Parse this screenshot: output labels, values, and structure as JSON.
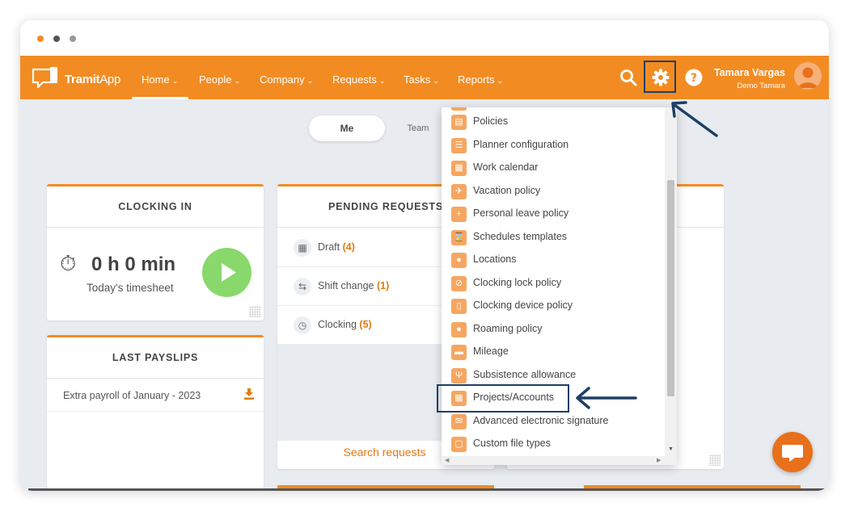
{
  "window": {
    "dots": [
      "#f28c22",
      "#555555",
      "#999999"
    ]
  },
  "navbar": {
    "brand": "TramitApp",
    "brand_parts": [
      "Tramit",
      "App"
    ],
    "color": "#f28c22",
    "items": [
      {
        "label": "Home"
      },
      {
        "label": "People"
      },
      {
        "label": "Company"
      },
      {
        "label": "Requests"
      },
      {
        "label": "Tasks"
      },
      {
        "label": "Reports"
      }
    ],
    "active_item": "Home",
    "icons": [
      "search-icon",
      "gear-icon",
      "help-icon"
    ],
    "user": {
      "name": "Tamara Vargas",
      "company": "Demo Tamara"
    }
  },
  "toggle": {
    "me": "Me",
    "team": "Team",
    "selected": "Me"
  },
  "clocking": {
    "title": "CLOCKING IN",
    "time": "0 h 0 min",
    "subtitle": "Today's timesheet"
  },
  "pending": {
    "title": "PENDING REQUESTS",
    "rows": [
      {
        "label": "Draft",
        "count": "(4)"
      },
      {
        "label": "Shift change",
        "count": "(1)"
      },
      {
        "label": "Clocking",
        "count": "(5)"
      }
    ],
    "search": "Search requests"
  },
  "payslips": {
    "title": "LAST PAYSLIPS",
    "item": "Extra payroll of January - 2023"
  },
  "settings_menu": {
    "items": [
      {
        "label": "Policies",
        "icon": "policies-icon"
      },
      {
        "label": "Planner configuration",
        "icon": "planner-icon"
      },
      {
        "label": "Work calendar",
        "icon": "calendar-icon"
      },
      {
        "label": "Vacation policy",
        "icon": "plane-icon"
      },
      {
        "label": "Personal leave policy",
        "icon": "calendar-plus-icon"
      },
      {
        "label": "Schedules templates",
        "icon": "hourglass-icon"
      },
      {
        "label": "Locations",
        "icon": "location-pin-icon"
      },
      {
        "label": "Clocking lock policy",
        "icon": "blocked-icon"
      },
      {
        "label": "Clocking device policy",
        "icon": "mobile-icon"
      },
      {
        "label": "Roaming policy",
        "icon": "location-pin-icon"
      },
      {
        "label": "Mileage",
        "icon": "car-icon"
      },
      {
        "label": "Subsistence allowance",
        "icon": "cutlery-icon"
      },
      {
        "label": "Projects/Accounts",
        "icon": "calculator-icon"
      },
      {
        "label": "Advanced electronic signature",
        "icon": "envelope-icon"
      },
      {
        "label": "Custom file types",
        "icon": "file-icon"
      }
    ],
    "highlighted": "Projects/Accounts"
  },
  "annotation_color": "#1e3f66"
}
